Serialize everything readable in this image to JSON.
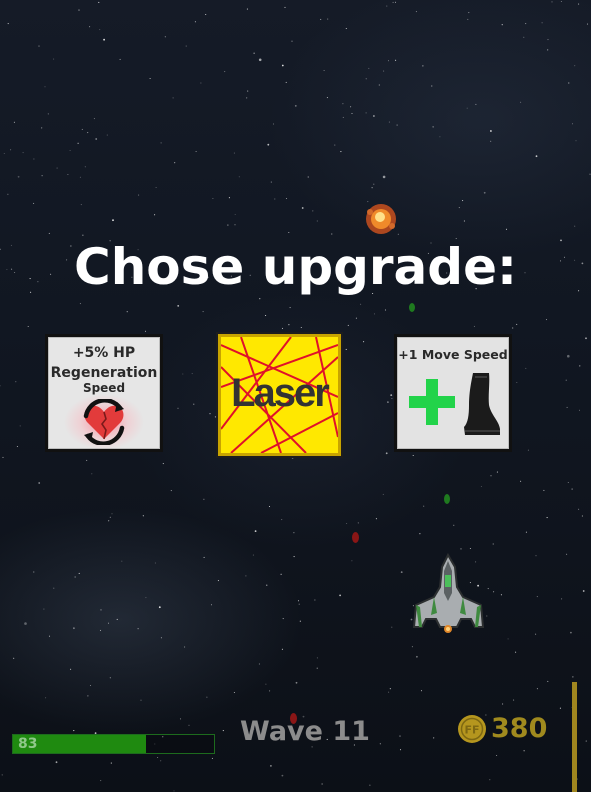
{
  "title": "Chose upgrade:",
  "upgrades": [
    {
      "line1": "+5% HP",
      "line2": "Regeneration",
      "line3": "Speed",
      "icon": "heart-regeneration-icon"
    },
    {
      "label": "Laser",
      "icon": "laser-beams-icon"
    },
    {
      "line1": "+1 Move Speed",
      "icons": [
        "plus-icon",
        "boot-icon"
      ]
    }
  ],
  "hud": {
    "hp_value": "83",
    "hp_fraction": 0.66,
    "wave_label": "Wave 11",
    "coins": "380",
    "coin_icon_text": "FF",
    "meter_fraction": 1.0
  },
  "colors": {
    "laser_card": "#ffe800",
    "laser_lines": "#e0102a",
    "hp_fill": "#1f8a10",
    "coin": "#b5961e",
    "plus": "#22d34a"
  }
}
